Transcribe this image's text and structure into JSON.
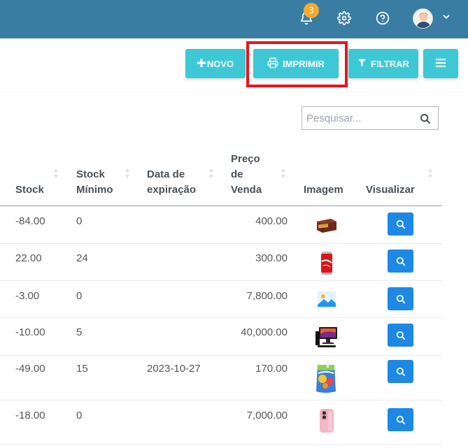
{
  "topbar": {
    "notification_count": "3",
    "icons": [
      "bell-icon",
      "gear-icon",
      "help-icon",
      "avatar",
      "chevron-down-icon"
    ]
  },
  "toolbar": {
    "novo_label": "NOVO",
    "imprimir_label": "IMPRIMIR",
    "filtrar_label": "FILTRAR",
    "accent_color": "#3ec8d6",
    "highlight_color": "#e5161b"
  },
  "search": {
    "placeholder": "Pesquisar..."
  },
  "table": {
    "headers": {
      "stock": "Stock",
      "stock_min_1": "Stock",
      "stock_min_2": "Mínimo",
      "expiry_1": "Data de",
      "expiry_2": "expiração",
      "price_1": "Preço",
      "price_2": "de",
      "price_3": "Venda",
      "image": "Imagem",
      "view": "Visualizar"
    },
    "rows": [
      {
        "stock": "-84.00",
        "stock_min": "0",
        "expiry": "",
        "price": "400.00",
        "image": "chocolate-box-image"
      },
      {
        "stock": "22.00",
        "stock_min": "24",
        "expiry": "",
        "price": "300.00",
        "image": "soda-can-image"
      },
      {
        "stock": "-3.00",
        "stock_min": "0",
        "expiry": "",
        "price": "7,800.00",
        "image": "image-placeholder-icon"
      },
      {
        "stock": "-10.00",
        "stock_min": "5",
        "expiry": "",
        "price": "40,000.00",
        "image": "computer-image"
      },
      {
        "stock": "-49.00",
        "stock_min": "15",
        "expiry": "2023-10-27",
        "price": "170.00",
        "image": "juice-pouch-image"
      },
      {
        "stock": "-18.00",
        "stock_min": "0",
        "expiry": "",
        "price": "7,000.00",
        "image": "phone-image"
      }
    ]
  }
}
